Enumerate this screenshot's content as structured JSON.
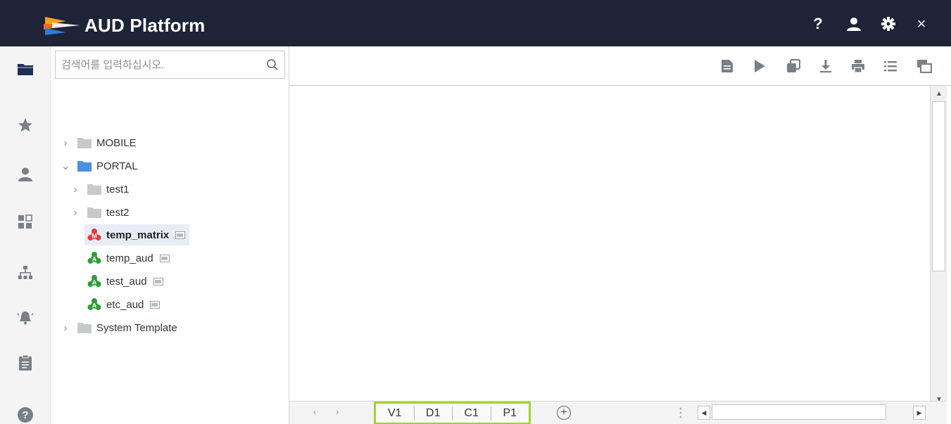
{
  "header": {
    "title": "AUD Platform",
    "help_label": "?",
    "close_label": "×"
  },
  "rail": {
    "items": [
      "folder-icon",
      "star-icon",
      "user-icon",
      "grid-icon",
      "org-chart-icon",
      "alarm-icon",
      "clipboard-icon",
      "help-circle-icon"
    ],
    "active_color": "#1e2d59",
    "inactive_color": "#7a7f88"
  },
  "search": {
    "placeholder": "검색어를 입력하십시오.",
    "value": ""
  },
  "tree": {
    "items": [
      {
        "label": "MOBILE",
        "type": "folder",
        "expanded": false
      },
      {
        "label": "PORTAL",
        "type": "folder",
        "expanded": true,
        "color": "#4a8fe0"
      },
      {
        "label": "test1",
        "type": "folder",
        "expanded": false
      },
      {
        "label": "test2",
        "type": "folder",
        "expanded": false
      },
      {
        "label": "temp_matrix",
        "type": "report",
        "badge": "M",
        "badge_color": "#e23c3c",
        "selected": true
      },
      {
        "label": "temp_aud",
        "type": "report",
        "badge": "A",
        "badge_color": "#2e9e3a"
      },
      {
        "label": "test_aud",
        "type": "report",
        "badge": "A",
        "badge_color": "#2e9e3a"
      },
      {
        "label": "etc_aud",
        "type": "report",
        "badge": "A",
        "badge_color": "#2e9e3a"
      },
      {
        "label": "System Template",
        "type": "folder",
        "expanded": false
      }
    ]
  },
  "toolbar": {
    "buttons": [
      "document-icon",
      "play-icon",
      "copy-icon",
      "download-icon",
      "print-icon",
      "list-icon",
      "window-icon"
    ]
  },
  "bottom": {
    "tabs": [
      "V1",
      "D1",
      "C1",
      "P1"
    ],
    "add_label": "+",
    "highlight_color": "#a3d12e"
  }
}
